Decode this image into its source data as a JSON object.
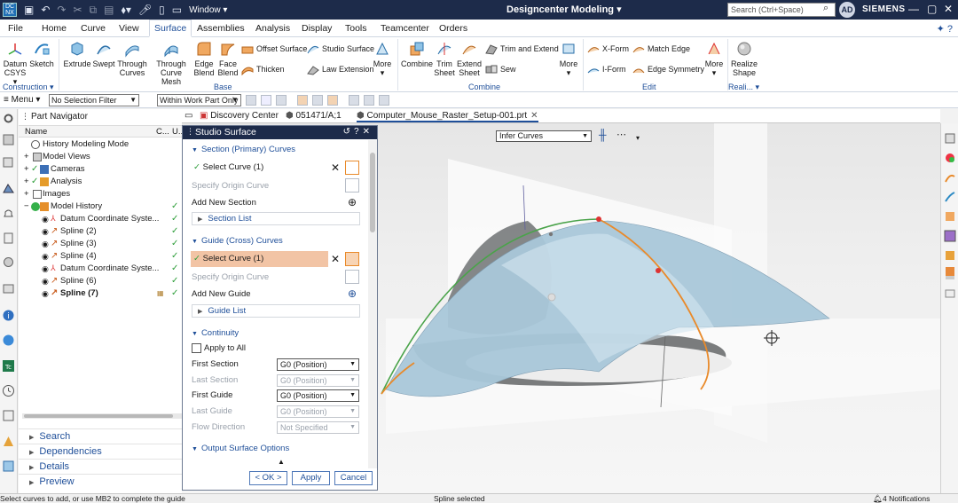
{
  "titlebar": {
    "logo": "DC NX",
    "window_menu": "Window ▾",
    "title": "Designcenter  Modeling ▾",
    "search_placeholder": "Search (Ctrl+Space)",
    "avatar": "AD",
    "brand": "SIEMENS"
  },
  "menu": {
    "tabs": [
      "File",
      "Home",
      "Curve",
      "View",
      "Surface",
      "Assemblies",
      "Analysis",
      "Display",
      "Tools",
      "Teamcenter",
      "Orders"
    ],
    "active": "Surface"
  },
  "ribbon": {
    "buttons": [
      {
        "label": "Datum\nCSYS ▾"
      },
      {
        "label": "Sketch"
      },
      {
        "label": "Extrude"
      },
      {
        "label": "Swept"
      },
      {
        "label": "Through\nCurves"
      },
      {
        "label": "Through\nCurve Mesh"
      },
      {
        "label": "Edge\nBlend"
      },
      {
        "label": "Face\nBlend"
      },
      {
        "label": "More"
      },
      {
        "label": "Combine"
      },
      {
        "label": "Trim\nSheet"
      },
      {
        "label": "Extend\nSheet"
      },
      {
        "label": "More"
      },
      {
        "label": "More"
      },
      {
        "label": "Realize\nShape"
      }
    ],
    "small": {
      "offset_surface": "Offset Surface",
      "studio_surface": "Studio Surface",
      "thicken": "Thicken",
      "law_extension": "Law Extension",
      "trim_extend": "Trim and Extend",
      "sew": "Sew",
      "x_form": "X-Form",
      "i_form": "I-Form",
      "match_edge": "Match Edge",
      "edge_symmetry": "Edge Symmetry"
    },
    "groups": {
      "construction": "Construction ▾",
      "base": "Base",
      "combine": "Combine",
      "edit": "Edit",
      "reali": "Reali... ▾"
    }
  },
  "toolrow": {
    "menu": "≡ Menu ▾",
    "selection_filter": "No Selection Filter",
    "scope": "Within Work Part Only"
  },
  "navigator": {
    "title": "Part Navigator",
    "col_name": "Name",
    "col_c": "C...",
    "col_u": "U...",
    "rows": [
      {
        "label": "History Modeling Mode",
        "indent": 0
      },
      {
        "label": "Model Views",
        "indent": 0
      },
      {
        "label": "Cameras",
        "indent": 0
      },
      {
        "label": "Analysis",
        "indent": 0
      },
      {
        "label": "Images",
        "indent": 0
      },
      {
        "label": "Model History",
        "indent": 0
      },
      {
        "label": "Datum Coordinate Syste...",
        "indent": 1
      },
      {
        "label": "Spline (2)",
        "indent": 1
      },
      {
        "label": "Spline (3)",
        "indent": 1
      },
      {
        "label": "Spline (4)",
        "indent": 1
      },
      {
        "label": "Datum Coordinate Syste...",
        "indent": 1
      },
      {
        "label": "Spline (6)",
        "indent": 1
      },
      {
        "label": "Spline (7)",
        "indent": 1
      }
    ],
    "bottom": [
      "Search",
      "Dependencies",
      "Details",
      "Preview"
    ]
  },
  "tabs": {
    "discovery": "Discovery Center",
    "part_a": "051471/A;1",
    "part_file": "Computer_Mouse_Raster_Setup-001.prt"
  },
  "viewport": {
    "infer_curves": "Infer Curves"
  },
  "dialog": {
    "title": "Studio Surface",
    "section_primary": "Section (Primary) Curves",
    "select_curve_1": "Select Curve (1)",
    "specify_origin_curve": "Specify Origin Curve",
    "add_new_section": "Add New Section",
    "section_list": "Section List",
    "guide_cross": "Guide (Cross) Curves",
    "select_curve_2": "Select Curve (1)",
    "specify_origin_curve_2": "Specify Origin Curve",
    "add_new_guide": "Add New Guide",
    "guide_list": "Guide List",
    "continuity": "Continuity",
    "apply_to_all": "Apply to All",
    "first_section": "First Section",
    "first_section_val": "G0 (Position)",
    "last_section": "Last Section",
    "last_section_val": "G0 (Position)",
    "first_guide": "First Guide",
    "first_guide_val": "G0 (Position)",
    "last_guide": "Last Guide",
    "last_guide_val": "G0 (Position)",
    "flow_direction": "Flow Direction",
    "flow_direction_val": "Not Specified",
    "output_options": "Output Surface Options",
    "ok": "< OK >",
    "apply": "Apply",
    "cancel": "Cancel"
  },
  "status": {
    "prompt": "Select curves to add, or use MB2 to complete the guide",
    "selection": "Spline selected",
    "notifications": "4 Notifications"
  },
  "colors": {
    "titlebar": "#1d2b4a",
    "accent": "#1f4f99",
    "selected_field": "#f2c4a5",
    "check": "#2e9e3a"
  }
}
